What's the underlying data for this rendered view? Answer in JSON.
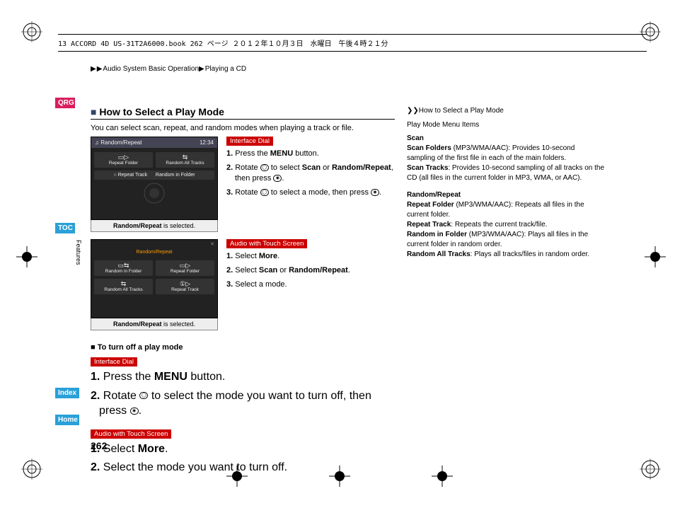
{
  "header": {
    "book_info": "13 ACCORD 4D US-31T2A6000.book  262 ページ  ２０１２年１０月３日　水曜日　午後４時２１分"
  },
  "breadcrumb": {
    "part1": "Audio System Basic Operation",
    "part2": "Playing a CD"
  },
  "nav": {
    "qrg": "QRG",
    "toc": "TOC",
    "features": "Features",
    "index": "Index",
    "home": "Home"
  },
  "page_number": "262",
  "main": {
    "section_title": "How to Select a Play Mode",
    "intro": "You can select scan, repeat, and random modes when playing a track or file.",
    "screenshot1": {
      "title": "♫ Random/Repeat",
      "time": "12:34",
      "cells": [
        "Repeat Folder",
        "Random All Tracks",
        "Repeat Track",
        "Random in Folder"
      ],
      "selected_row": "○ Repeat Track",
      "caption_bold": "Random/Repeat",
      "caption_rest": " is selected."
    },
    "badge_dial": "Interface Dial",
    "dial_steps": {
      "s1a": "Press the ",
      "s1b": "MENU",
      "s1c": " button.",
      "s2a": "Rotate ",
      "s2b": " to select ",
      "s2c": "Scan",
      "s2d": " or ",
      "s2e": "Random/Repeat",
      "s2f": ", then press ",
      "s3a": "Rotate ",
      "s3b": " to select a mode, then press "
    },
    "screenshot2": {
      "cells": [
        "Random in Folder",
        "Repeat Folder",
        "Random All Tracks",
        "Repeat Track"
      ],
      "caption_bold": "Random/Repeat",
      "caption_rest": " is selected."
    },
    "badge_touch": "Audio with Touch Screen",
    "touch_steps": {
      "s1a": "Select ",
      "s1b": "More",
      "s2a": "Select ",
      "s2b": "Scan",
      "s2c": " or ",
      "s2d": "Random/Repeat",
      "s3": "Select a mode."
    },
    "sub_title": "To turn off a play mode",
    "off_dial": {
      "s1a": "Press the ",
      "s1b": "MENU",
      "s1c": " button.",
      "s2a": "Rotate ",
      "s2b": " to select the mode you want to turn off, then press "
    },
    "off_touch": {
      "s1a": "Select ",
      "s1b": "More",
      "s2": "Select the mode you want to turn off."
    }
  },
  "right": {
    "head": "How to Select a Play Mode",
    "sub1": "Play Mode Menu Items",
    "scan_h": "Scan",
    "scan_folders_h": "Scan Folders",
    "scan_folders_t": " (MP3/WMA/AAC): Provides 10-second sampling of the first file in each of the main folders.",
    "scan_tracks_h": "Scan Tracks",
    "scan_tracks_t": ": Provides 10-second sampling of all tracks on the CD (all files in the current folder in MP3, WMA, or AAC).",
    "rr_h": "Random/Repeat",
    "rf_h": "Repeat Folder",
    "rf_t": " (MP3/WMA/AAC): Repeats all files in the current folder.",
    "rt_h": "Repeat Track",
    "rt_t": ": Repeats the current track/file.",
    "rif_h": "Random in Folder",
    "rif_t": " (MP3/WMA/AAC): Plays all files in the current folder in random order.",
    "rat_h": "Random All Tracks",
    "rat_t": ": Plays all tracks/files in random order."
  }
}
